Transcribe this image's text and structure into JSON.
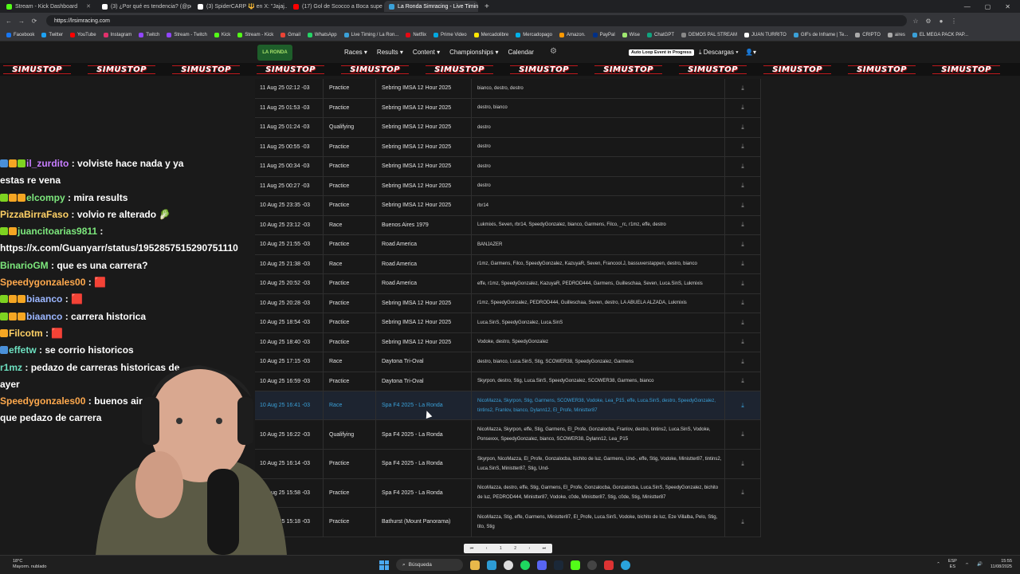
{
  "browser": {
    "tabs": [
      {
        "title": "Stream - Kick Dashboard",
        "color": "#53fc18",
        "active": false
      },
      {
        "title": "(3) ¿Por qué es tendencia? (@po...",
        "color": "#ffffff",
        "active": false
      },
      {
        "title": "(3) SpiderCARP 🔱 en X: \"Jajaj...",
        "color": "#ffffff",
        "active": false
      },
      {
        "title": "(17) Gol de Scocco a Boca superl...",
        "color": "#ff0000",
        "active": false
      },
      {
        "title": "La Ronda Simracing - Live Timing",
        "color": "#3aa0d8",
        "active": true
      }
    ],
    "new_tab": "+",
    "url": "https://lrsimracing.com",
    "bookmarks": [
      "Facebook",
      "Twitter",
      "YouTube",
      "Instagram",
      "Twitch",
      "Stream - Twitch",
      "Kick",
      "Stream - Kick",
      "Gmail",
      "WhatsApp",
      "Live Timing / La Ron...",
      "Netflix",
      "Prime Video",
      "Mercadolibre",
      "Mercadopago",
      "Amazon.",
      "PayPal",
      "Wise",
      "ChatGPT",
      "DEMOS PAL STREAM",
      "JUAN TURRITO",
      "GIFs de Inframe | Te...",
      "CRIPTO",
      "aires",
      "EL MEGA PACK PAP..."
    ]
  },
  "site": {
    "logo_text": "LA RONDA",
    "menu": [
      "Races ▾",
      "Results ▾",
      "Content ▾",
      "Championships ▾",
      "Calendar"
    ],
    "badge": "Auto Loop Event in Progress",
    "descargas": "Descargas ▾",
    "ticker_text": "SIMUSTOP"
  },
  "results": [
    {
      "date": "11 Aug 25 02:12 -03",
      "session": "Practice",
      "track": "Sebring IMSA 12 Hour 2025",
      "drivers": "bianco, destro, destro"
    },
    {
      "date": "11 Aug 25 01:53 -03",
      "session": "Practice",
      "track": "Sebring IMSA 12 Hour 2025",
      "drivers": "destro, bianco"
    },
    {
      "date": "11 Aug 25 01:24 -03",
      "session": "Qualifying",
      "track": "Sebring IMSA 12 Hour 2025",
      "drivers": "destro"
    },
    {
      "date": "11 Aug 25 00:55 -03",
      "session": "Practice",
      "track": "Sebring IMSA 12 Hour 2025",
      "drivers": "destro"
    },
    {
      "date": "11 Aug 25 00:34 -03",
      "session": "Practice",
      "track": "Sebring IMSA 12 Hour 2025",
      "drivers": "destro"
    },
    {
      "date": "11 Aug 25 00:27 -03",
      "session": "Practice",
      "track": "Sebring IMSA 12 Hour 2025",
      "drivers": "destro"
    },
    {
      "date": "10 Aug 25 23:35 -03",
      "session": "Practice",
      "track": "Sebring IMSA 12 Hour 2025",
      "drivers": "rbr14"
    },
    {
      "date": "10 Aug 25 23:12 -03",
      "session": "Race",
      "track": "Buenos Aires 1979",
      "drivers": "Lukmixis, Seven, rbr14, SpeedyGonzalez, bianco, Garmens, Filco, _rc, r1mz, effe, destro"
    },
    {
      "date": "10 Aug 25 21:55 -03",
      "session": "Practice",
      "track": "Road America",
      "drivers": "BANJAZER"
    },
    {
      "date": "10 Aug 25 21:38 -03",
      "session": "Race",
      "track": "Road America",
      "drivers": "r1mz, Garmens, Filco, SpeedyGonzalez, KazuyaR, Seven, Francool.J, bassuverstappen, destro, bianco"
    },
    {
      "date": "10 Aug 25 20:52 -03",
      "session": "Practice",
      "track": "Road America",
      "drivers": "effe, r1mz, SpeedyGonzalez, KazuyaR, PEDROD444, Garmens, Guilleschaa, Seven, Luca.SinS, Lukmixis"
    },
    {
      "date": "10 Aug 25 20:28 -03",
      "session": "Practice",
      "track": "Sebring IMSA 12 Hour 2025",
      "drivers": "r1mz, SpeedyGonzalez, PEDROD444, Guilleschaa, Seven, destro, LA ABUELA ALZADA, Lukmixis"
    },
    {
      "date": "10 Aug 25 18:54 -03",
      "session": "Practice",
      "track": "Sebring IMSA 12 Hour 2025",
      "drivers": "Luca.SinS, SpeedyGonzalez, Luca.SinS"
    },
    {
      "date": "10 Aug 25 18:40 -03",
      "session": "Practice",
      "track": "Sebring IMSA 12 Hour 2025",
      "drivers": "Vodoke, destro, SpeedyGonzalez"
    },
    {
      "date": "10 Aug 25 17:15 -03",
      "session": "Race",
      "track": "Daytona Tri-Oval",
      "drivers": "destro, bianco, Luca.SinS, Stig, SCOWER38, SpeedyGonzalez, Garmens"
    },
    {
      "date": "10 Aug 25 16:59 -03",
      "session": "Practice",
      "track": "Daytona Tri-Oval",
      "drivers": "Skyrpon, destro, Stig, Luca.SinS, SpeedyGonzalez, SCOWER38, Garmens, bianco"
    },
    {
      "date": "10 Aug 25 16:41 -03",
      "session": "Race",
      "track": "Spa F4 2025 - La Ronda",
      "drivers": "NicoMazza, Skyrpon, Stig, Garmens, SCOWER38, Vodoke, Lea_P15, effe, Luca.SinS, destro, SpeedyGonzalez, tintins2, Franlov, bianco, Dylann12, El_Profe, Ministter87"
    },
    {
      "date": "10 Aug 25 16:22 -03",
      "session": "Qualifying",
      "track": "Spa F4 2025 - La Ronda",
      "drivers": "NicoMazza, Skyrpon, effe, Stig, Garmens, El_Profe, Gonzalocba, Franlov, destro, tintins2, Luca.SinS, Vodoke, Ponsexxx, SpeedyGonzalez, bianco, SCOWER38, Dylann12, Lea_P15"
    },
    {
      "date": "10 Aug 25 16:14 -03",
      "session": "Practice",
      "track": "Spa F4 2025 - La Ronda",
      "drivers": "Skyrpon, NicoMazza, El_Profe, Gonzalocba, bichito de luz, Garmens, Und-, effe, Stig, Vodoke, Ministter87, tintins2, Luca.SinS, Ministter87, Stig, Und-"
    },
    {
      "date": "10 Aug 25 15:58 -03",
      "session": "Practice",
      "track": "Spa F4 2025 - La Ronda",
      "drivers": "NicoMazza, destro, effe, Stig, Garmens, El_Profe, Gonzalocba, Gonzalocba, Luca.SinS, SpeedyGonzalez, bichito de luz, PEDROD444, Ministter87, Vodoke, c0de, Ministter87, Stig, c0de, Stig, Ministter87"
    },
    {
      "date": "10 Aug 25 15:18 -03",
      "session": "Practice",
      "track": "Bathurst (Mount Panorama)",
      "drivers": "NicoMazza, Stig, effe, Garmens, Ministter87, El_Profe, Luca.SinS, Vodoke, bichito de luz, Eze Villalba, Pelo, Stig, tito, Stig"
    }
  ],
  "pager": [
    "⏮",
    "‹",
    "1",
    "2",
    "›",
    "⏭"
  ],
  "chat": [
    {
      "user": "il_zurdito",
      "msg": ": volviste hace nada y ya estas re vena",
      "cls": "u1",
      "badges": [
        "#4a90d9",
        "#f5a623",
        "#7ed321"
      ]
    },
    {
      "user": "elcompy",
      "msg": ": mira results",
      "cls": "u2",
      "badges": [
        "#7ed321",
        "#f5a623",
        "#f5a623"
      ]
    },
    {
      "user": "PizzaBirraFaso",
      "msg": ": volvio re alterado 🥬",
      "cls": "u3",
      "badges": []
    },
    {
      "user": "juancitoarias9811",
      "msg": ": https://x.com/Guanyarr/status/1952857515290751110",
      "cls": "u2",
      "badges": [
        "#7ed321",
        "#f5a623"
      ]
    },
    {
      "user": "BinarioGM",
      "msg": ": que es una carrera?",
      "cls": "u2",
      "badges": []
    },
    {
      "user": "Speedygonzales00",
      "msg": ": 🟥",
      "cls": "u4",
      "badges": []
    },
    {
      "user": "biaanco",
      "msg": ": 🟥",
      "cls": "u5",
      "badges": [
        "#7ed321",
        "#f5a623",
        "#f5a623"
      ]
    },
    {
      "user": "biaanco",
      "msg": ": carrera historica",
      "cls": "u5",
      "badges": [
        "#7ed321",
        "#f5a623",
        "#f5a623"
      ]
    },
    {
      "user": "Filcotm",
      "msg": ": 🟥",
      "cls": "u3",
      "badges": [
        "#f5a623"
      ]
    },
    {
      "user": "effetw",
      "msg": ": se corrio historicos",
      "cls": "u6",
      "badges": [
        "#4a90d9"
      ]
    },
    {
      "user": "r1mz",
      "msg": ": pedazo de carreras historicas de ayer",
      "cls": "u6",
      "badges": []
    },
    {
      "user": "Speedygonzales00",
      "msg": ": buenos aires pelotudo que pedazo de carrera",
      "cls": "u4",
      "badges": []
    }
  ],
  "taskbar": {
    "weather_temp": "18°C",
    "weather_desc": "Mayorm. nublado",
    "search": "Búsqueda",
    "lang": "ESP",
    "lang2": "ES",
    "time": "15:55",
    "date": "11/08/2025"
  },
  "colors": {
    "accent": "#3aa0d8",
    "brand_red": "#c0181d",
    "bg": "#181818"
  }
}
